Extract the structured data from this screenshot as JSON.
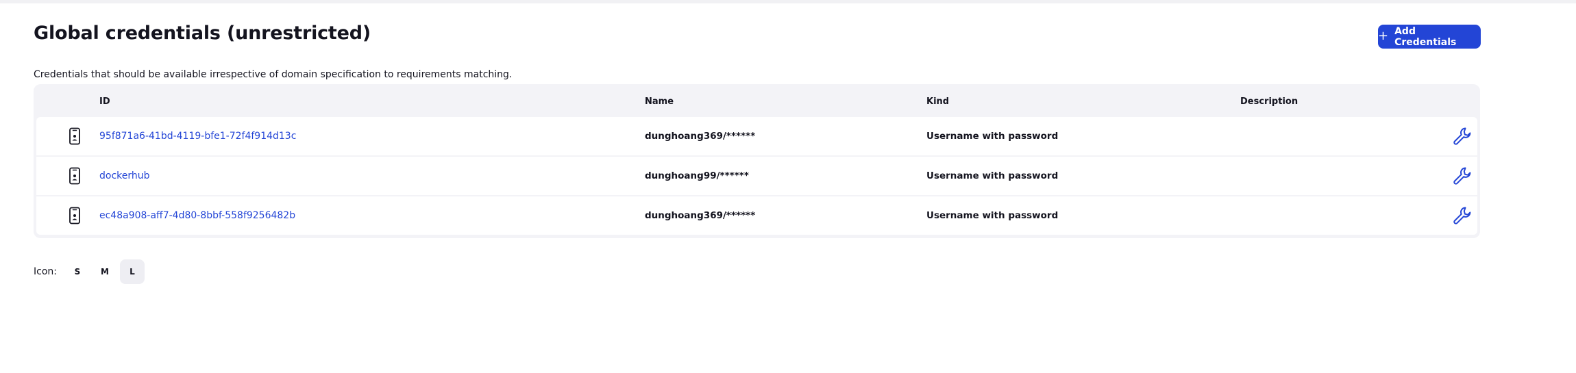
{
  "header": {
    "title": "Global credentials (unrestricted)",
    "add_button_label": "Add Credentials",
    "add_button_icon": "plus-icon"
  },
  "description": "Credentials that should be available irrespective of domain specification to requirements matching.",
  "table": {
    "columns": [
      "",
      "ID",
      "Name",
      "Kind",
      "Description",
      ""
    ],
    "rows": [
      {
        "type_icon": "mobile-credential-icon",
        "id": "95f871a6-41bd-4119-bfe1-72f4f914d13c",
        "name": "dunghoang369/******",
        "kind": "Username with password",
        "description": "",
        "action_icon": "wrench-icon"
      },
      {
        "type_icon": "mobile-credential-icon",
        "id": "dockerhub",
        "name": "dunghoang99/******",
        "kind": "Username with password",
        "description": "",
        "action_icon": "wrench-icon"
      },
      {
        "type_icon": "mobile-credential-icon",
        "id": "ec48a908-aff7-4d80-8bbf-558f9256482b",
        "name": "dunghoang369/******",
        "kind": "Username with password",
        "description": "",
        "action_icon": "wrench-icon"
      }
    ]
  },
  "icon_size": {
    "label": "Icon:",
    "options": [
      "S",
      "M",
      "L"
    ],
    "selected": "L"
  },
  "colors": {
    "accent": "#2345d6",
    "link": "#2345d6",
    "table_bg": "#f3f3f7",
    "text": "#14141f"
  }
}
